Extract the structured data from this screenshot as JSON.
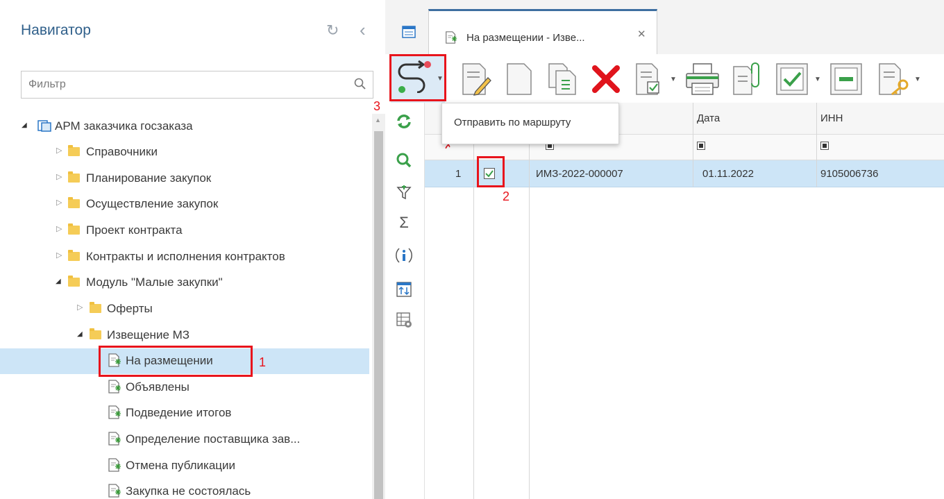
{
  "navigator": {
    "title": "Навигатор",
    "filter_placeholder": "Фильтр",
    "tree": [
      {
        "label": "АРМ заказчика госзаказа"
      },
      {
        "label": "Справочники"
      },
      {
        "label": "Планирование закупок"
      },
      {
        "label": "Осуществление закупок"
      },
      {
        "label": "Проект контракта"
      },
      {
        "label": "Контракты и исполнения контрактов"
      },
      {
        "label": "Модуль \"Малые закупки\""
      },
      {
        "label": "Оферты"
      },
      {
        "label": "Извещение МЗ"
      },
      {
        "label": "На размещении"
      },
      {
        "label": "Объявлены"
      },
      {
        "label": "Подведение итогов"
      },
      {
        "label": "Определение поставщика зав..."
      },
      {
        "label": "Отмена публикации"
      },
      {
        "label": "Закупка не состоялась"
      }
    ]
  },
  "tab": {
    "title": "На размещении - Изве..."
  },
  "tooltip": {
    "text": "Отправить по маршруту"
  },
  "grid": {
    "headers": {
      "date": "Дата",
      "inn": "ИНН"
    },
    "rows": [
      {
        "num": "1",
        "number": "ИМЗ-2022-000007",
        "date": "01.11.2022",
        "inn": "9105006736"
      }
    ]
  },
  "annotations": {
    "one": "1",
    "two": "2",
    "three": "3"
  },
  "colors": {
    "accent": "#3d6ea0",
    "selection": "#cde5f7",
    "highlight": "#e8141c",
    "folder": "#f5cc57"
  }
}
